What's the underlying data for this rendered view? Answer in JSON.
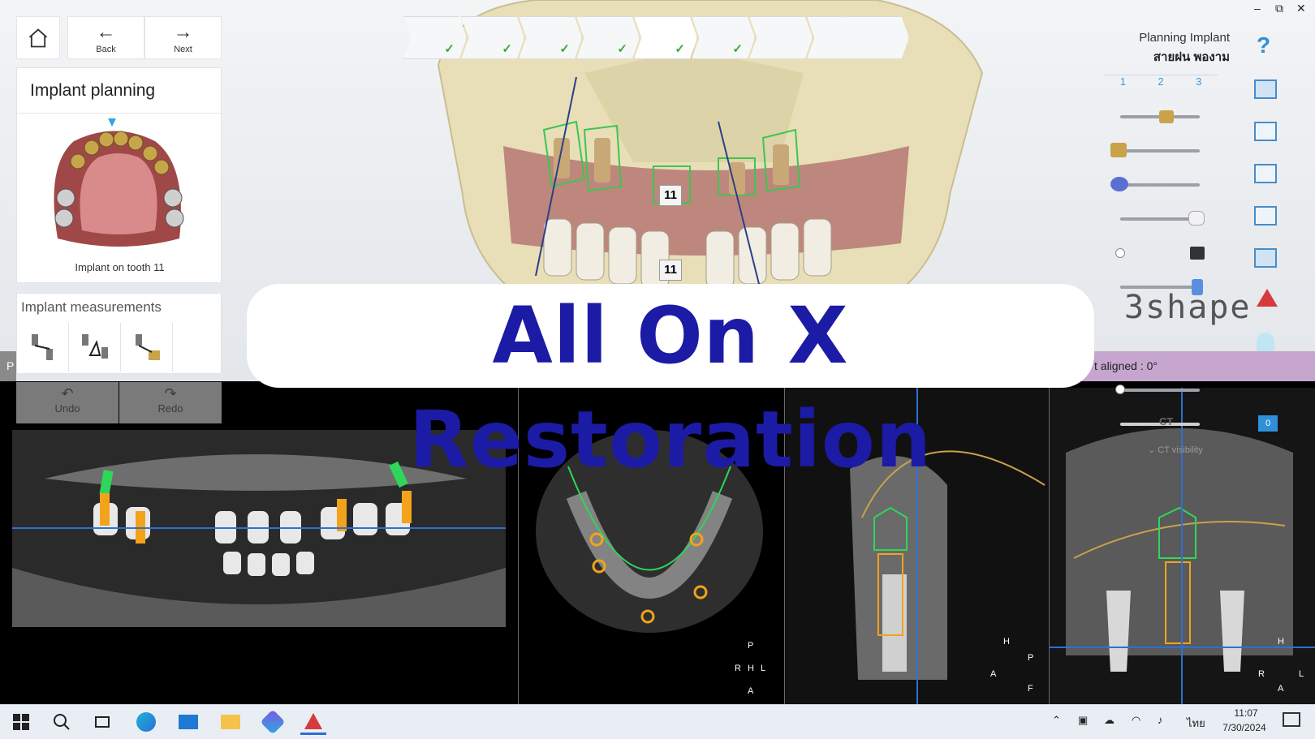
{
  "window": {
    "minimize": "–",
    "restore": "⧉",
    "close": "✕"
  },
  "nav": {
    "home_icon": "home-icon",
    "back_label": "Back",
    "next_label": "Next"
  },
  "left_panel": {
    "title": "Implant planning",
    "caption": "Implant on tooth 11",
    "measurements_title": "Implant measurements",
    "undo_label": "Undo",
    "redo_label": "Redo"
  },
  "header": {
    "title": "Planning Implant",
    "patient": "สายฝน พองาม",
    "help": "?"
  },
  "tabs": [
    "1",
    "2",
    "3"
  ],
  "scene": {
    "tooth_label_upper": "11",
    "tooth_label_lower": "11"
  },
  "status": {
    "aligned_text": "t aligned : 0°",
    "left_text": "P"
  },
  "ct": {
    "ct_label": "CT",
    "visibility_label": "CT visibility",
    "badge": "0"
  },
  "brand": "3shape",
  "overlay_title": "All On X Restoration",
  "orientation": {
    "axial": {
      "top": "P",
      "left": "R",
      "center": "H",
      "right": "L",
      "bottom": "A"
    },
    "sagittal": {
      "top": "H",
      "right": "P",
      "left": "A",
      "bottom": "F"
    },
    "coronal": {
      "top": "H",
      "left": "R",
      "right": "L",
      "bottom": "A"
    }
  },
  "taskbar": {
    "language": "ไทย",
    "time": "11:07",
    "date": "7/30/2024"
  },
  "colors": {
    "title": "#1c1ba6",
    "implant_green": "#2fd65a",
    "implant_orange": "#f2a31b",
    "nav_line": "#2f6fd6",
    "gum": "#b06a6a",
    "bone": "#e8dfb8"
  }
}
